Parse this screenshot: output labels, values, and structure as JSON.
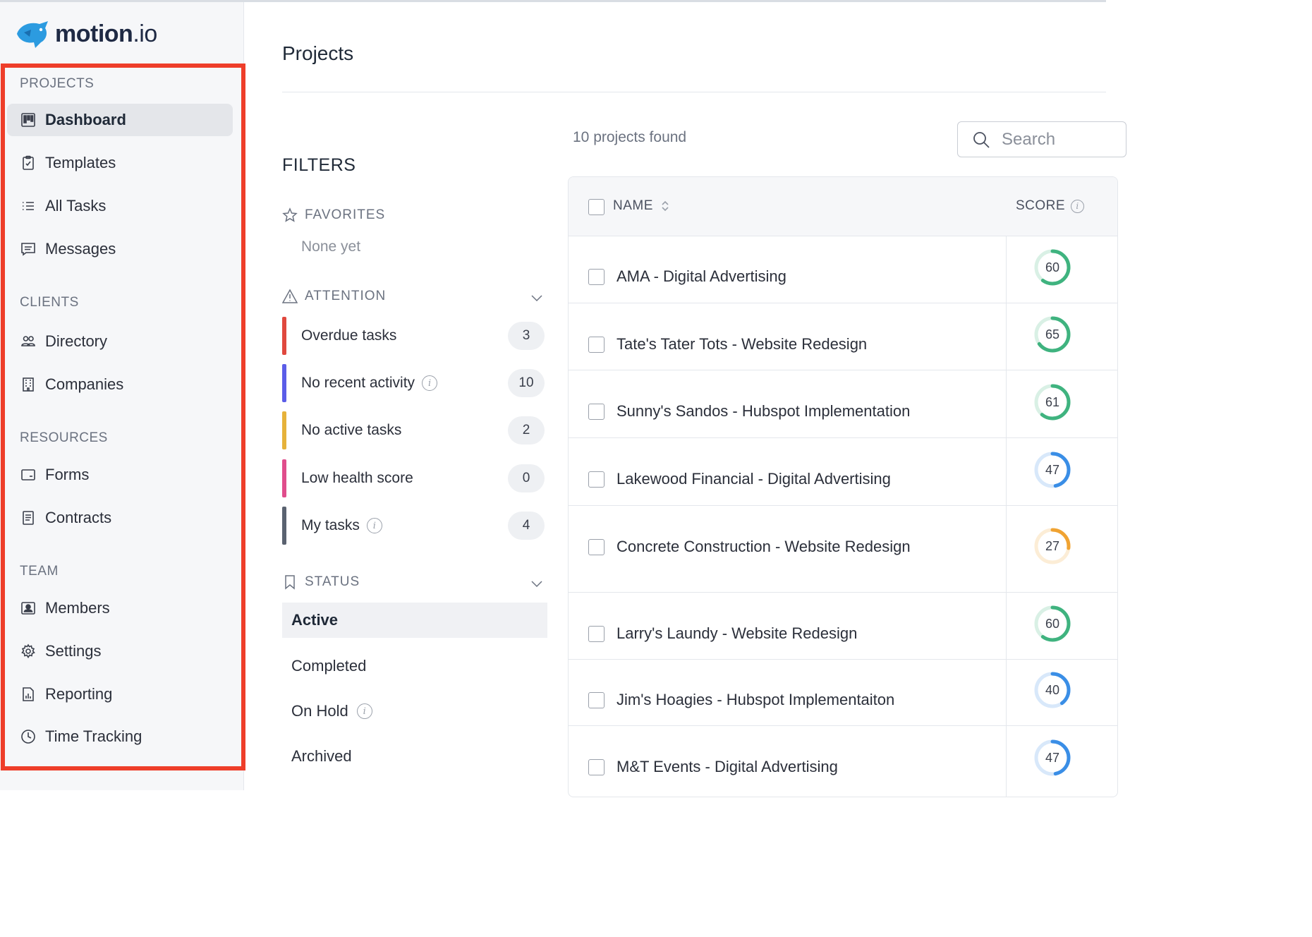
{
  "app": {
    "logo_name": "motion",
    "logo_suffix": ".io"
  },
  "sidebar": {
    "groups": [
      {
        "title": "PROJECTS",
        "items": [
          {
            "label": "Dashboard",
            "icon": "kanban-board-icon",
            "active": true
          },
          {
            "label": "Templates",
            "icon": "clipboard-check-icon"
          },
          {
            "label": "All Tasks",
            "icon": "list-icon"
          },
          {
            "label": "Messages",
            "icon": "message-icon"
          }
        ]
      },
      {
        "title": "CLIENTS",
        "items": [
          {
            "label": "Directory",
            "icon": "people-icon"
          },
          {
            "label": "Companies",
            "icon": "building-icon"
          }
        ]
      },
      {
        "title": "RESOURCES",
        "items": [
          {
            "label": "Forms",
            "icon": "form-icon"
          },
          {
            "label": "Contracts",
            "icon": "document-icon"
          }
        ]
      },
      {
        "title": "TEAM",
        "items": [
          {
            "label": "Members",
            "icon": "member-card-icon"
          },
          {
            "label": "Settings",
            "icon": "gear-icon"
          },
          {
            "label": "Reporting",
            "icon": "report-icon"
          },
          {
            "label": "Time Tracking",
            "icon": "clock-icon"
          }
        ]
      }
    ],
    "highlight_color": "#ee3e2a"
  },
  "main": {
    "title": "Projects",
    "filters": {
      "title": "FILTERS",
      "favorites": {
        "title": "FAVORITES",
        "empty_text": "None yet"
      },
      "attention": {
        "title": "ATTENTION",
        "items": [
          {
            "label": "Overdue tasks",
            "count": "3",
            "color": "#e0483e",
            "info": false
          },
          {
            "label": "No recent activity",
            "count": "10",
            "color": "#5b5de8",
            "info": true
          },
          {
            "label": "No active tasks",
            "count": "2",
            "color": "#e6b23a",
            "info": false
          },
          {
            "label": "Low health score",
            "count": "0",
            "color": "#e04d8c",
            "info": false
          },
          {
            "label": "My tasks",
            "count": "4",
            "color": "#5a6270",
            "info": true
          }
        ]
      },
      "status": {
        "title": "STATUS",
        "items": [
          {
            "label": "Active",
            "active": true,
            "info": false
          },
          {
            "label": "Completed",
            "active": false,
            "info": false
          },
          {
            "label": "On Hold",
            "active": false,
            "info": true
          },
          {
            "label": "Archived",
            "active": false,
            "info": false
          }
        ]
      }
    },
    "results_count": "10 projects found",
    "search": {
      "placeholder": "Search",
      "value": ""
    },
    "table": {
      "columns": {
        "name": "NAME",
        "score": "SCORE"
      },
      "rows": [
        {
          "name": "AMA - Digital Advertising",
          "score": 60,
          "color": "#3fb37f"
        },
        {
          "name": "Tate's Tater Tots - Website Redesign",
          "score": 65,
          "color": "#3fb37f"
        },
        {
          "name": "Sunny's Sandos - Hubspot Implementation",
          "score": 61,
          "color": "#3fb37f"
        },
        {
          "name": "Lakewood Financial - Digital Advertising",
          "score": 47,
          "color": "#3a8ee6"
        },
        {
          "name": "Concrete Construction - Website Redesign",
          "score": 27,
          "color": "#f0a332"
        },
        {
          "name": "Larry's Laundy - Website Redesign",
          "score": 60,
          "color": "#3fb37f"
        },
        {
          "name": "Jim's Hoagies - Hubspot Implementaiton",
          "score": 40,
          "color": "#3a8ee6"
        },
        {
          "name": "M&T Events - Digital Advertising",
          "score": 47,
          "color": "#3a8ee6"
        }
      ]
    }
  }
}
